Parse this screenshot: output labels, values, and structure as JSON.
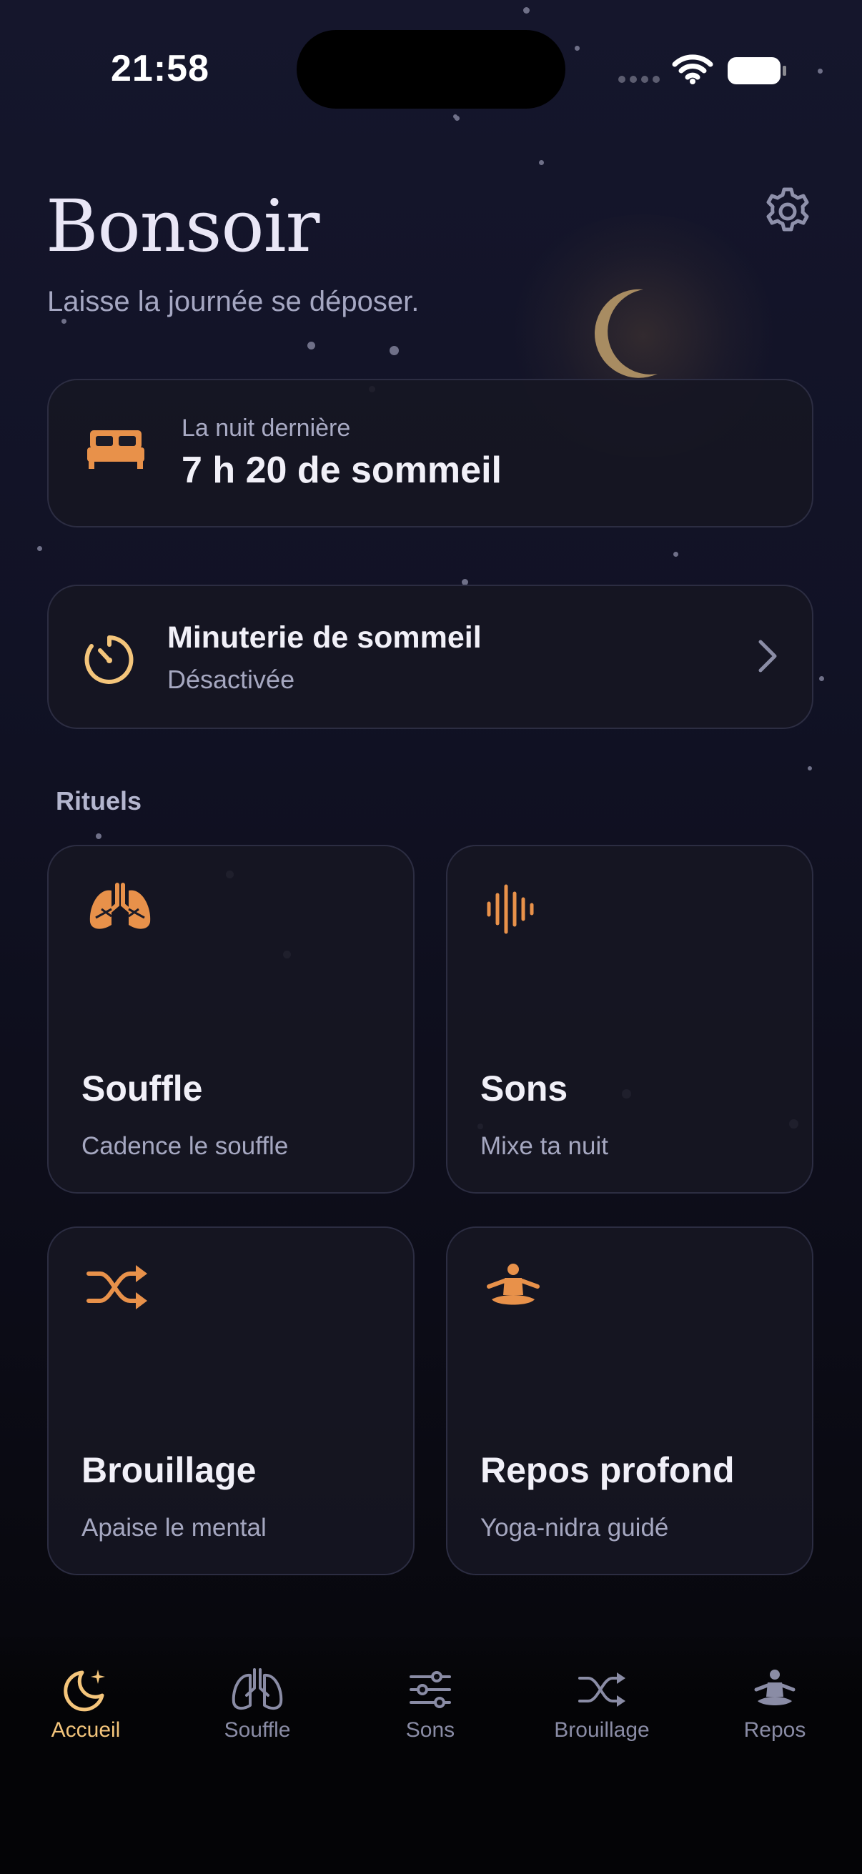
{
  "status_bar": {
    "time": "21:58"
  },
  "header": {
    "title": "Bonsoir",
    "subtitle": "Laisse la journée se déposer."
  },
  "sleep_summary": {
    "label": "La nuit dernière",
    "value": "7 h 20 de sommeil"
  },
  "sleep_timer": {
    "title": "Minuterie de sommeil",
    "status": "Désactivée"
  },
  "rituals": {
    "section_label": "Rituels",
    "items": [
      {
        "title": "Souffle",
        "subtitle": "Cadence le souffle",
        "icon": "lungs-icon"
      },
      {
        "title": "Sons",
        "subtitle": "Mixe ta nuit",
        "icon": "soundwave-icon"
      },
      {
        "title": "Brouillage",
        "subtitle": "Apaise le mental",
        "icon": "shuffle-icon"
      },
      {
        "title": "Repos profond",
        "subtitle": "Yoga-nidra guidé",
        "icon": "meditation-icon"
      }
    ]
  },
  "tabs": [
    {
      "label": "Accueil",
      "icon": "moon-stars-icon",
      "active": true
    },
    {
      "label": "Souffle",
      "icon": "lungs-icon",
      "active": false
    },
    {
      "label": "Sons",
      "icon": "sliders-icon",
      "active": false
    },
    {
      "label": "Brouillage",
      "icon": "shuffle-icon",
      "active": false
    },
    {
      "label": "Repos",
      "icon": "meditation-icon",
      "active": false
    }
  ],
  "colors": {
    "accent": "#e8914a",
    "active_tab": "#f4c57b",
    "moon": "#a88c62",
    "background": "#111225"
  }
}
